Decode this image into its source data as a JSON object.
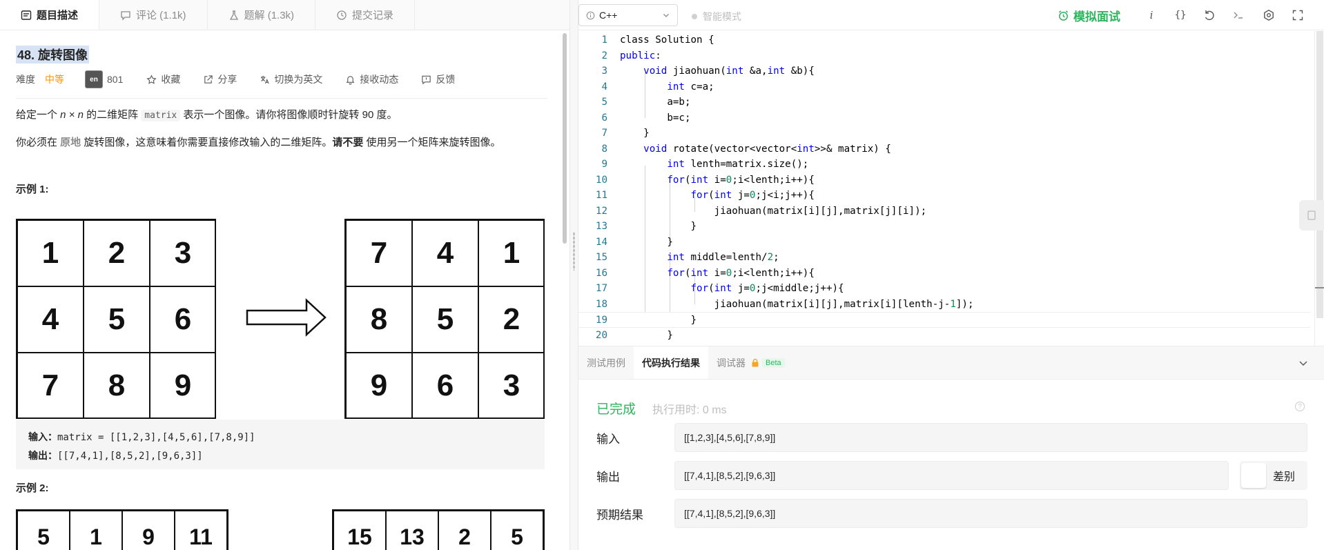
{
  "left_tabs": [
    {
      "label": "题目描述"
    },
    {
      "label": "评论 (1.1k)"
    },
    {
      "label": "题解 (1.3k)"
    },
    {
      "label": "提交记录"
    }
  ],
  "problem": {
    "title": "48. 旋转图像",
    "difficulty_label": "难度",
    "difficulty": "中等",
    "badge_text": "en",
    "likes": "801",
    "actions": [
      "收藏",
      "分享",
      "切换为英文",
      "接收动态",
      "反馈"
    ],
    "p1_a": "给定一个 ",
    "p1_n": "n × n",
    "p1_b": " 的二维矩阵 ",
    "p1_code": "matrix",
    "p1_c": " 表示一个图像。请你将图像顺时针旋转 90 度。",
    "p2_a": "你必须在 ",
    "p2_hl": "原地",
    "p2_b": " 旋转图像，这意味着你需要直接修改输入的二维矩阵。",
    "p2_bold": "请不要",
    "p2_c": " 使用另一个矩阵来旋转图像。",
    "example1_title": "示例 1:",
    "example2_title": "示例 2:",
    "grid_before": [
      "1",
      "2",
      "3",
      "4",
      "5",
      "6",
      "7",
      "8",
      "9"
    ],
    "grid_after": [
      "7",
      "4",
      "1",
      "8",
      "5",
      "2",
      "9",
      "6",
      "3"
    ],
    "grid2_before": [
      "5",
      "1",
      "9",
      "11"
    ],
    "grid2_after": [
      "15",
      "13",
      "2",
      "5"
    ],
    "input_label": "输入：",
    "input_value": "matrix = [[1,2,3],[4,5,6],[7,8,9]]",
    "output_label": "输出：",
    "output_value": "[[7,4,1],[8,5,2],[9,6,3]]"
  },
  "toolbar": {
    "language": "C++",
    "smart_mode": "智能模式",
    "mock_interview": "模拟面试",
    "info_icon_text": "i",
    "braces_icon_text": "{}"
  },
  "code_lines": [
    {
      "n": "1",
      "html": "class Solution {"
    },
    {
      "n": "2",
      "html": "<span class=\"kw\">public</span>:"
    },
    {
      "n": "3",
      "html": "    <span class=\"kw\">void</span> jiaohuan(<span class=\"kw\">int</span> &amp;a,<span class=\"kw\">int</span> &amp;b){"
    },
    {
      "n": "4",
      "html": "        <span class=\"kw\">int</span> c=a;"
    },
    {
      "n": "5",
      "html": "        a=b;"
    },
    {
      "n": "6",
      "html": "        b=c;"
    },
    {
      "n": "7",
      "html": "    }"
    },
    {
      "n": "8",
      "html": "    <span class=\"kw\">void</span> rotate(vector&lt;vector&lt;<span class=\"kw\">int</span>&gt;&gt;&amp; matrix) {"
    },
    {
      "n": "9",
      "html": "        <span class=\"kw\">int</span> lenth=matrix.size();"
    },
    {
      "n": "10",
      "html": "        <span class=\"kw\">for</span>(<span class=\"kw\">int</span> i=<span class=\"nm\">0</span>;i&lt;lenth;i++){"
    },
    {
      "n": "11",
      "html": "            <span class=\"kw\">for</span>(<span class=\"kw\">int</span> j=<span class=\"nm\">0</span>;j&lt;i;j++){"
    },
    {
      "n": "12",
      "html": "                jiaohuan(matrix[i][j],matrix[j][i]);"
    },
    {
      "n": "13",
      "html": "            }"
    },
    {
      "n": "14",
      "html": "        }"
    },
    {
      "n": "15",
      "html": "        <span class=\"kw\">int</span> middle=lenth/<span class=\"nm\">2</span>;"
    },
    {
      "n": "16",
      "html": "        <span class=\"kw\">for</span>(<span class=\"kw\">int</span> i=<span class=\"nm\">0</span>;i&lt;lenth;i++){"
    },
    {
      "n": "17",
      "html": "            <span class=\"kw\">for</span>(<span class=\"kw\">int</span> j=<span class=\"nm\">0</span>;j&lt;middle;j++){"
    },
    {
      "n": "18",
      "html": "                jiaohuan(matrix[i][j],matrix[i][lenth-j-<span class=\"nm\">1</span>]);"
    },
    {
      "n": "19",
      "html": "            }"
    },
    {
      "n": "20",
      "html": "        }"
    }
  ],
  "console": {
    "tabs": [
      "测试用例",
      "代码执行结果",
      "调试器"
    ],
    "beta": "Beta",
    "status": "已完成",
    "runtime": "执行用时: 0 ms",
    "help_text": "?",
    "input_label": "输入",
    "input_value": "[[1,2,3],[4,5,6],[7,8,9]]",
    "output_label": "输出",
    "output_value": "[[7,4,1],[8,5,2],[9,6,3]]",
    "diff_label": "差别",
    "expected_label": "预期结果",
    "expected_value": "[[7,4,1],[8,5,2],[9,6,3]]"
  },
  "colors": {
    "accent_green": "#2db55d",
    "difficulty_orange": "#ff9200",
    "keyword_blue": "#0000ff",
    "line_number": "#237893"
  }
}
